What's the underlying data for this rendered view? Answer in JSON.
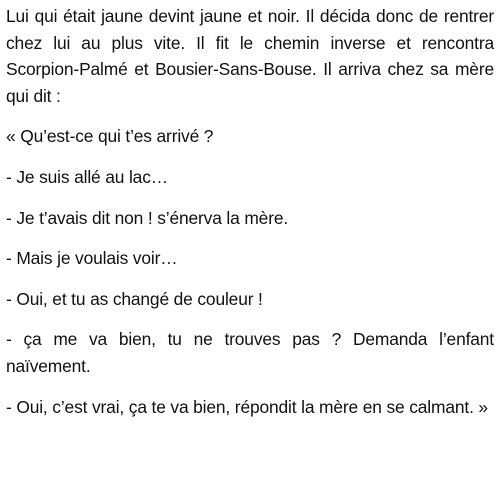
{
  "document": {
    "paragraphs": [
      "Lui qui était jaune devint jaune et noir.  Il décida donc de rentrer chez lui au plus vite. Il fit le chemin inverse et rencontra Scorpion-Palmé et Bousier-Sans-Bouse. Il arriva chez sa mère qui dit :",
      "« Qu’est-ce qui t’es arrivé ?",
      "- Je suis allé au lac…",
      "- Je t’avais dit non ! s’énerva la mère.",
      "- Mais je voulais voir…",
      "- Oui, et tu as changé de couleur !",
      "- ça me va bien, tu ne trouves pas ? Demanda  l’enfant naïvement.",
      "- Oui, c’est vrai, ça te va bien, répondit la mère en se calmant. »"
    ]
  }
}
